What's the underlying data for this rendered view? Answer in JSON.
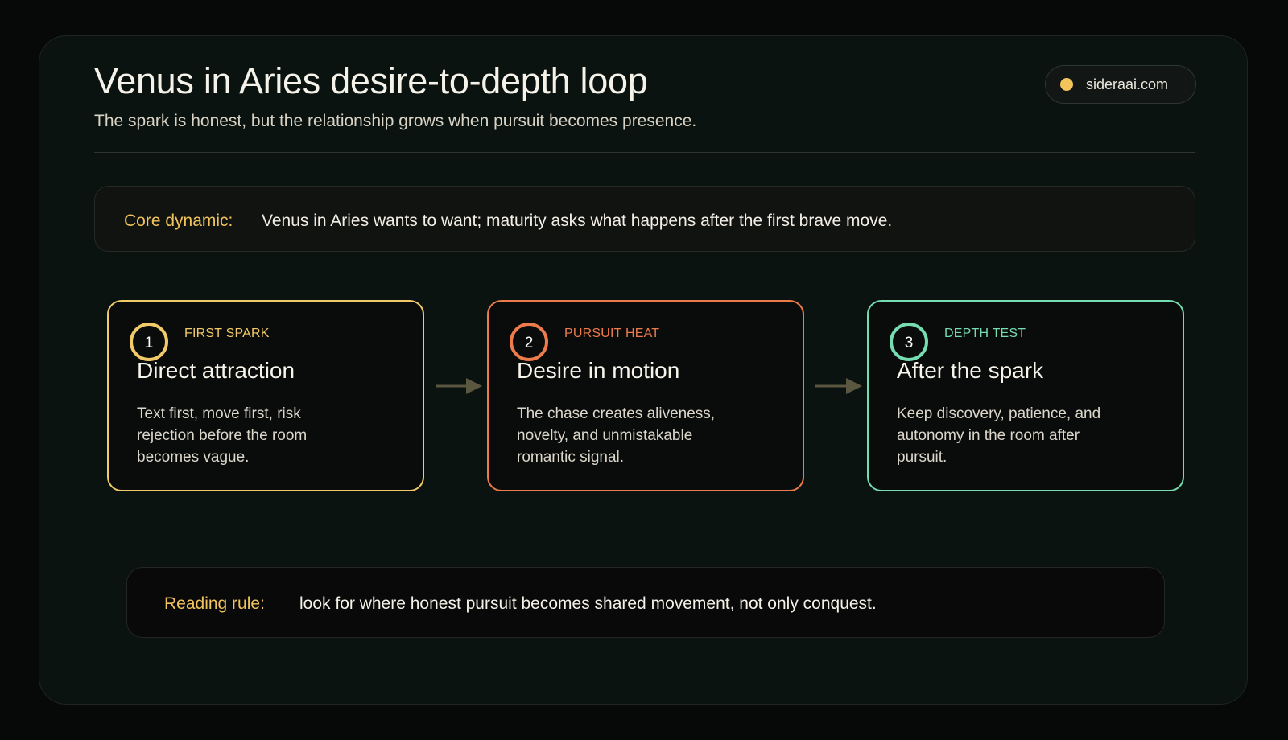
{
  "header": {
    "title": "Venus in Aries desire-to-depth loop",
    "subtitle": "The spark is honest, but the relationship grows when pursuit becomes presence.",
    "site": "sideraai.com"
  },
  "core": {
    "label": "Core dynamic:",
    "text": "Venus in Aries wants to want; maturity asks what happens after the first brave move."
  },
  "cards": [
    {
      "number": "1",
      "tag": "FIRST SPARK",
      "title": "Direct attraction",
      "description": "Text first, move first, risk rejection before the room becomes vague.",
      "color": "#f2ca6a"
    },
    {
      "number": "2",
      "tag": "PURSUIT HEAT",
      "title": "Desire in motion",
      "description": "The chase creates aliveness, novelty, and unmistakable romantic signal.",
      "color": "#ee7b4c"
    },
    {
      "number": "3",
      "tag": "DEPTH TEST",
      "title": "After the spark",
      "description": "Keep discovery, patience, and autonomy in the room after pursuit.",
      "color": "#76dcb2"
    }
  ],
  "rule": {
    "label": "Reading rule:",
    "text": "look for where honest pursuit becomes shared movement, not only conquest."
  },
  "colors": {
    "background": "#070808",
    "panel": "#0b1310",
    "accent_gold": "#f1c35c",
    "arrow": "#5a5640"
  }
}
